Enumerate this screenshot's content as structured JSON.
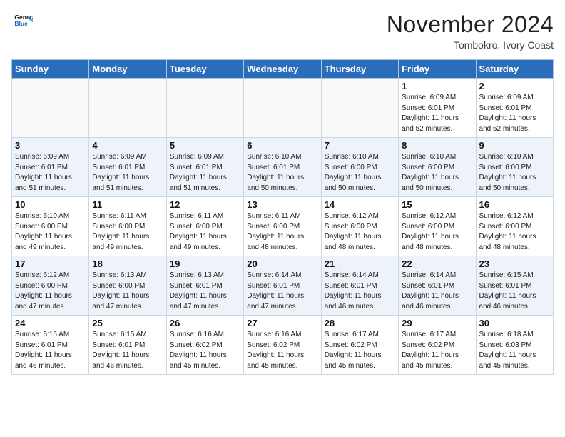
{
  "header": {
    "logo_line1": "General",
    "logo_line2": "Blue",
    "month": "November 2024",
    "location": "Tombokro, Ivory Coast"
  },
  "weekdays": [
    "Sunday",
    "Monday",
    "Tuesday",
    "Wednesday",
    "Thursday",
    "Friday",
    "Saturday"
  ],
  "weeks": [
    [
      {
        "day": "",
        "info": ""
      },
      {
        "day": "",
        "info": ""
      },
      {
        "day": "",
        "info": ""
      },
      {
        "day": "",
        "info": ""
      },
      {
        "day": "",
        "info": ""
      },
      {
        "day": "1",
        "info": "Sunrise: 6:09 AM\nSunset: 6:01 PM\nDaylight: 11 hours\nand 52 minutes."
      },
      {
        "day": "2",
        "info": "Sunrise: 6:09 AM\nSunset: 6:01 PM\nDaylight: 11 hours\nand 52 minutes."
      }
    ],
    [
      {
        "day": "3",
        "info": "Sunrise: 6:09 AM\nSunset: 6:01 PM\nDaylight: 11 hours\nand 51 minutes."
      },
      {
        "day": "4",
        "info": "Sunrise: 6:09 AM\nSunset: 6:01 PM\nDaylight: 11 hours\nand 51 minutes."
      },
      {
        "day": "5",
        "info": "Sunrise: 6:09 AM\nSunset: 6:01 PM\nDaylight: 11 hours\nand 51 minutes."
      },
      {
        "day": "6",
        "info": "Sunrise: 6:10 AM\nSunset: 6:01 PM\nDaylight: 11 hours\nand 50 minutes."
      },
      {
        "day": "7",
        "info": "Sunrise: 6:10 AM\nSunset: 6:00 PM\nDaylight: 11 hours\nand 50 minutes."
      },
      {
        "day": "8",
        "info": "Sunrise: 6:10 AM\nSunset: 6:00 PM\nDaylight: 11 hours\nand 50 minutes."
      },
      {
        "day": "9",
        "info": "Sunrise: 6:10 AM\nSunset: 6:00 PM\nDaylight: 11 hours\nand 50 minutes."
      }
    ],
    [
      {
        "day": "10",
        "info": "Sunrise: 6:10 AM\nSunset: 6:00 PM\nDaylight: 11 hours\nand 49 minutes."
      },
      {
        "day": "11",
        "info": "Sunrise: 6:11 AM\nSunset: 6:00 PM\nDaylight: 11 hours\nand 49 minutes."
      },
      {
        "day": "12",
        "info": "Sunrise: 6:11 AM\nSunset: 6:00 PM\nDaylight: 11 hours\nand 49 minutes."
      },
      {
        "day": "13",
        "info": "Sunrise: 6:11 AM\nSunset: 6:00 PM\nDaylight: 11 hours\nand 48 minutes."
      },
      {
        "day": "14",
        "info": "Sunrise: 6:12 AM\nSunset: 6:00 PM\nDaylight: 11 hours\nand 48 minutes."
      },
      {
        "day": "15",
        "info": "Sunrise: 6:12 AM\nSunset: 6:00 PM\nDaylight: 11 hours\nand 48 minutes."
      },
      {
        "day": "16",
        "info": "Sunrise: 6:12 AM\nSunset: 6:00 PM\nDaylight: 11 hours\nand 48 minutes."
      }
    ],
    [
      {
        "day": "17",
        "info": "Sunrise: 6:12 AM\nSunset: 6:00 PM\nDaylight: 11 hours\nand 47 minutes."
      },
      {
        "day": "18",
        "info": "Sunrise: 6:13 AM\nSunset: 6:00 PM\nDaylight: 11 hours\nand 47 minutes."
      },
      {
        "day": "19",
        "info": "Sunrise: 6:13 AM\nSunset: 6:01 PM\nDaylight: 11 hours\nand 47 minutes."
      },
      {
        "day": "20",
        "info": "Sunrise: 6:14 AM\nSunset: 6:01 PM\nDaylight: 11 hours\nand 47 minutes."
      },
      {
        "day": "21",
        "info": "Sunrise: 6:14 AM\nSunset: 6:01 PM\nDaylight: 11 hours\nand 46 minutes."
      },
      {
        "day": "22",
        "info": "Sunrise: 6:14 AM\nSunset: 6:01 PM\nDaylight: 11 hours\nand 46 minutes."
      },
      {
        "day": "23",
        "info": "Sunrise: 6:15 AM\nSunset: 6:01 PM\nDaylight: 11 hours\nand 46 minutes."
      }
    ],
    [
      {
        "day": "24",
        "info": "Sunrise: 6:15 AM\nSunset: 6:01 PM\nDaylight: 11 hours\nand 46 minutes."
      },
      {
        "day": "25",
        "info": "Sunrise: 6:15 AM\nSunset: 6:01 PM\nDaylight: 11 hours\nand 46 minutes."
      },
      {
        "day": "26",
        "info": "Sunrise: 6:16 AM\nSunset: 6:02 PM\nDaylight: 11 hours\nand 45 minutes."
      },
      {
        "day": "27",
        "info": "Sunrise: 6:16 AM\nSunset: 6:02 PM\nDaylight: 11 hours\nand 45 minutes."
      },
      {
        "day": "28",
        "info": "Sunrise: 6:17 AM\nSunset: 6:02 PM\nDaylight: 11 hours\nand 45 minutes."
      },
      {
        "day": "29",
        "info": "Sunrise: 6:17 AM\nSunset: 6:02 PM\nDaylight: 11 hours\nand 45 minutes."
      },
      {
        "day": "30",
        "info": "Sunrise: 6:18 AM\nSunset: 6:03 PM\nDaylight: 11 hours\nand 45 minutes."
      }
    ]
  ]
}
